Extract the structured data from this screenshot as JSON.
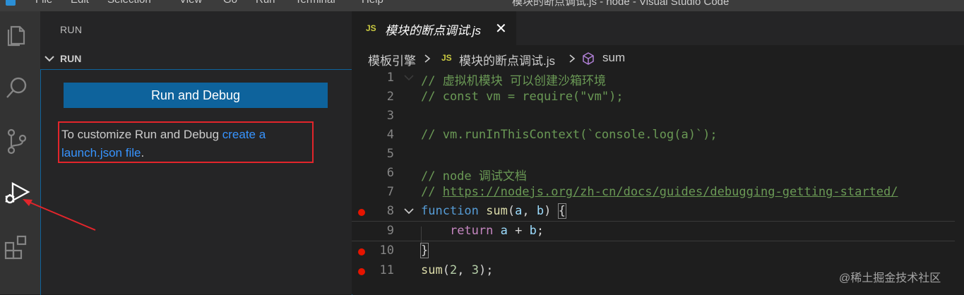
{
  "window": {
    "menu": [
      "File",
      "Edit",
      "Selection",
      "View",
      "Go",
      "Run",
      "Terminal",
      "Help"
    ],
    "title": "模块的断点调试.js - node - Visual Studio Code"
  },
  "activity_bar": {
    "items": [
      {
        "name": "explorer-icon",
        "active": false
      },
      {
        "name": "search-icon",
        "active": false
      },
      {
        "name": "source-control-icon",
        "active": false
      },
      {
        "name": "run-debug-icon",
        "active": true
      },
      {
        "name": "extensions-icon",
        "active": false
      }
    ]
  },
  "sidebar": {
    "title": "RUN",
    "section_label": "RUN",
    "run_button_label": "Run and Debug",
    "hint_text": "To customize Run and Debug ",
    "hint_link": "create a launch.json file",
    "hint_end": "."
  },
  "editor": {
    "tab_lang": "JS",
    "tab_name": "模块的断点调试.js",
    "tab_close": "✕",
    "breadcrumb": {
      "folder": "模板引擎",
      "lang": "JS",
      "file": "模块的断点调试.js",
      "symbol": "sum"
    },
    "lines": [
      {
        "n": "1",
        "breakpoint": false
      },
      {
        "n": "2",
        "breakpoint": false
      },
      {
        "n": "3",
        "breakpoint": false
      },
      {
        "n": "4",
        "breakpoint": false
      },
      {
        "n": "5",
        "breakpoint": false
      },
      {
        "n": "6",
        "breakpoint": false
      },
      {
        "n": "7",
        "breakpoint": false
      },
      {
        "n": "8",
        "breakpoint": true
      },
      {
        "n": "9",
        "breakpoint": false
      },
      {
        "n": "10",
        "breakpoint": true
      },
      {
        "n": "11",
        "breakpoint": true
      }
    ],
    "code": {
      "l1": "// 虚拟机模块 可以创建沙箱环境",
      "l2": "// const vm = require(\"vm\");",
      "l4": "// vm.runInThisContext(`console.log(a)`);",
      "l6": "// node 调试文档",
      "l7_prefix": "// ",
      "l7_link": "https://nodejs.org/zh-cn/docs/guides/debugging-getting-started/",
      "l8_kw": "function",
      "l8_fn": "sum",
      "l8_open": "(",
      "l8_a": "a",
      "l8_comma": ", ",
      "l8_b": "b",
      "l8_close": ") ",
      "l8_brace": "{",
      "l9_kw": "return",
      "l9_a": "a",
      "l9_op": " + ",
      "l9_b": "b",
      "l9_end": ";",
      "l10": "}",
      "l11_fn": "sum",
      "l11_open": "(",
      "l11_n1": "2",
      "l11_comma": ", ",
      "l11_n2": "3",
      "l11_end": ");"
    }
  },
  "watermark": "@稀土掘金技术社区",
  "colors": {
    "accent": "#0e639c",
    "breakpoint": "#e51400",
    "highlight_box": "#e2252b"
  }
}
